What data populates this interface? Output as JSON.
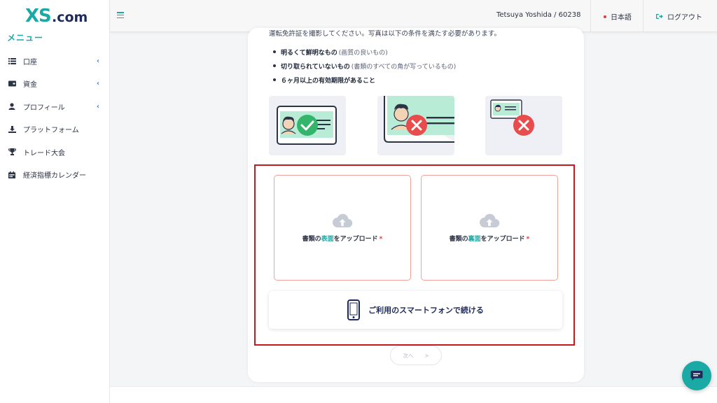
{
  "brand": {
    "logo_text": "XS.com"
  },
  "sidebar": {
    "menu_title": "メニュー",
    "items": [
      {
        "label": "口座",
        "icon": "list-icon",
        "has_chevron": true
      },
      {
        "label": "資金",
        "icon": "wallet-icon",
        "has_chevron": true
      },
      {
        "label": "プロフィール",
        "icon": "user-icon",
        "has_chevron": true
      },
      {
        "label": "プラットフォーム",
        "icon": "download-icon",
        "has_chevron": false
      },
      {
        "label": "トレード大会",
        "icon": "trophy-icon",
        "has_chevron": false
      },
      {
        "label": "経済指標カレンダー",
        "icon": "calendar-icon",
        "has_chevron": false
      }
    ],
    "chevron": "‹"
  },
  "header": {
    "user": "Tetsuya Yoshida / 60238",
    "language": "日本語",
    "logout": "ログアウト"
  },
  "content": {
    "intro_text": "運転免許証を撮影してください。写真は以下の条件を満たす必要があります。",
    "bullets": [
      {
        "bold": "明るくて鮮明なもの",
        "note": "(画質の良いもの)"
      },
      {
        "bold": "切り取られていないもの",
        "note": "(書類のすべての角が写っているもの)"
      },
      {
        "bold": "６ヶ月以上の有効期限があること",
        "note": ""
      }
    ],
    "upload_front": {
      "prefix": "書類の",
      "highlight": "表面",
      "suffix": "をアップロード",
      "required": "*"
    },
    "upload_back": {
      "prefix": "書類の",
      "highlight": "裏面",
      "suffix": "をアップロード",
      "required": "*"
    },
    "phone_button": "ご利用のスマートフォンで続ける",
    "next_button": {
      "label": "次へ",
      "arrow": ">"
    }
  },
  "colors": {
    "brand_teal": "#1aa9a5",
    "frame_red": "#c8181e",
    "error_red": "#e84c4c",
    "ok_green": "#33b56b"
  }
}
